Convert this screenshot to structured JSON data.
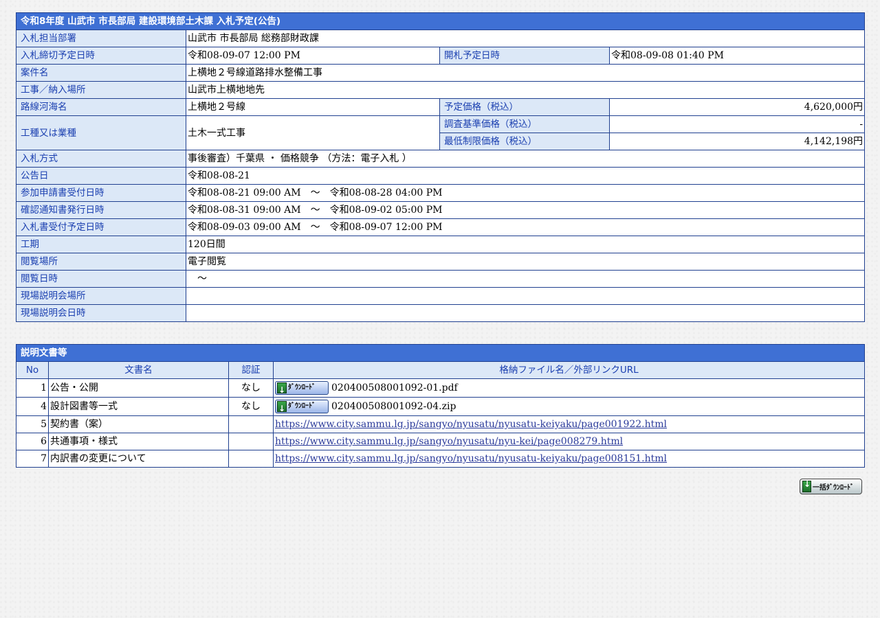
{
  "header": {
    "title": "令和8年度 山武市 市長部局 建設環境部土木課 入札予定(公告)"
  },
  "info": {
    "dept_label": "入札担当部署",
    "dept": "山武市 市長部局 総務部財政課",
    "deadline_label": "入札締切予定日時",
    "deadline": "令和08-09-07 12:00 PM",
    "open_label": "開札予定日時",
    "open": "令和08-09-08 01:40 PM",
    "name_label": "案件名",
    "name": "上横地２号線道路排水整備工事",
    "place_label": "工事／納入場所",
    "place": "山武市上横地地先",
    "route_label": "路線河海名",
    "route": "上横地２号線",
    "price_label": "予定価格（税込）",
    "price": "4,620,000円",
    "type_label": "工種又は業種",
    "type": "土木一式工事",
    "survey_label": "調査基準価格（税込）",
    "survey": "-",
    "min_label": "最低制限価格（税込）",
    "min": "4,142,198円",
    "method_label": "入札方式",
    "method": "事後審査）千葉県 ・ 価格競争 （方法：電子入札 ）",
    "notice_label": "公告日",
    "notice": "令和08-08-21",
    "apply_label": "参加申請書受付日時",
    "apply": "令和08-08-21 09:00 AM　～　令和08-08-28 04:00 PM",
    "confirm_label": "確認通知書発行日時",
    "confirm": "令和08-08-31 09:00 AM　～　令和08-09-02 05:00 PM",
    "bid_label": "入札書受付予定日時",
    "bid": "令和08-09-03 09:00 AM　～　令和08-09-07 12:00 PM",
    "period_label": "工期",
    "period": "120日間",
    "view_place_label": "閲覧場所",
    "view_place": "電子閲覧",
    "view_date_label": "閲覧日時",
    "view_date": "　～",
    "site_place_label": "現場説明会場所",
    "site_place": "",
    "site_date_label": "現場説明会日時",
    "site_date": ""
  },
  "docs": {
    "title": "説明文書等",
    "col_no": "No",
    "col_name": "文書名",
    "col_auth": "認証",
    "col_file": "格納ファイル名／外部リンクURL",
    "download_label": "ﾀﾞｳﾝﾛｰﾄﾞ",
    "rows": [
      {
        "no": "1",
        "name": "公告・公開",
        "auth": "なし",
        "file": "020400508001092-01.pdf"
      },
      {
        "no": "4",
        "name": "設計図書等一式",
        "auth": "なし",
        "file": "020400508001092-04.zip"
      },
      {
        "no": "5",
        "name": "契約書（案）",
        "auth": "",
        "link": "https://www.city.sammu.lg.jp/sangyo/nyusatu/nyusatu-keiyaku/page001922.html"
      },
      {
        "no": "6",
        "name": "共通事項・様式",
        "auth": "",
        "link": "https://www.city.sammu.lg.jp/sangyo/nyusatu/nyu-kei/page008279.html"
      },
      {
        "no": "7",
        "name": "内訳書の変更について",
        "auth": "",
        "link": "https://www.city.sammu.lg.jp/sangyo/nyusatu/nyusatu-keiyaku/page008151.html"
      }
    ],
    "bulk_label": "一括ﾀﾞｳﾝﾛｰﾄﾞ"
  }
}
